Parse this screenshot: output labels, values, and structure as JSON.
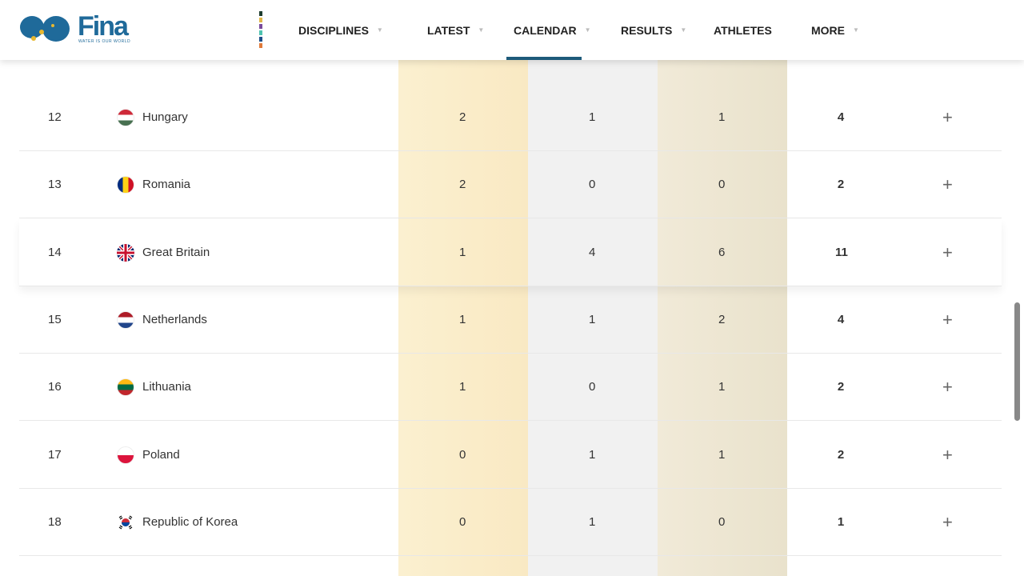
{
  "header": {
    "logo_text": "Fina",
    "logo_tagline": "WATER IS OUR WORLD",
    "nav": [
      {
        "label": "DISCIPLINES",
        "caret": true
      },
      {
        "label": "LATEST",
        "caret": true
      },
      {
        "label": "CALENDAR",
        "caret": true,
        "active": true
      },
      {
        "label": "RESULTS",
        "caret": true
      },
      {
        "label": "ATHLETES",
        "caret": false
      },
      {
        "label": "MORE",
        "caret": true
      }
    ],
    "stripe_colors": [
      "#1e3d2f",
      "#e2b74a",
      "#7a4b9c",
      "#4fc3b0",
      "#1f4f8a",
      "#e07a3a"
    ],
    "accent": "#1d5a7a"
  },
  "medal_table": {
    "rows": [
      {
        "rank": "12",
        "country": "Hungary",
        "gold": "2",
        "silver": "1",
        "bronze": "1",
        "total": "4",
        "flag": [
          "#ce2939",
          "#ffffff",
          "#477050"
        ]
      },
      {
        "rank": "13",
        "country": "Romania",
        "gold": "2",
        "silver": "0",
        "bronze": "0",
        "total": "2",
        "flag": [
          "#002b7f",
          "#fcd116",
          "#ce1126"
        ],
        "vertical": true
      },
      {
        "rank": "14",
        "country": "Great Britain",
        "gold": "1",
        "silver": "4",
        "bronze": "6",
        "total": "11",
        "flag": "uk"
      },
      {
        "rank": "15",
        "country": "Netherlands",
        "gold": "1",
        "silver": "1",
        "bronze": "2",
        "total": "4",
        "flag": [
          "#ae1c28",
          "#ffffff",
          "#21468b"
        ]
      },
      {
        "rank": "16",
        "country": "Lithuania",
        "gold": "1",
        "silver": "0",
        "bronze": "1",
        "total": "2",
        "flag": [
          "#fdb913",
          "#006a44",
          "#c1272d"
        ]
      },
      {
        "rank": "17",
        "country": "Poland",
        "gold": "0",
        "silver": "1",
        "bronze": "1",
        "total": "2",
        "flag": [
          "#ffffff",
          "#dc143c"
        ]
      },
      {
        "rank": "18",
        "country": "Republic of Korea",
        "gold": "0",
        "silver": "1",
        "bronze": "0",
        "total": "1",
        "flag": "kr"
      }
    ],
    "expand_icon": "plus-icon"
  }
}
